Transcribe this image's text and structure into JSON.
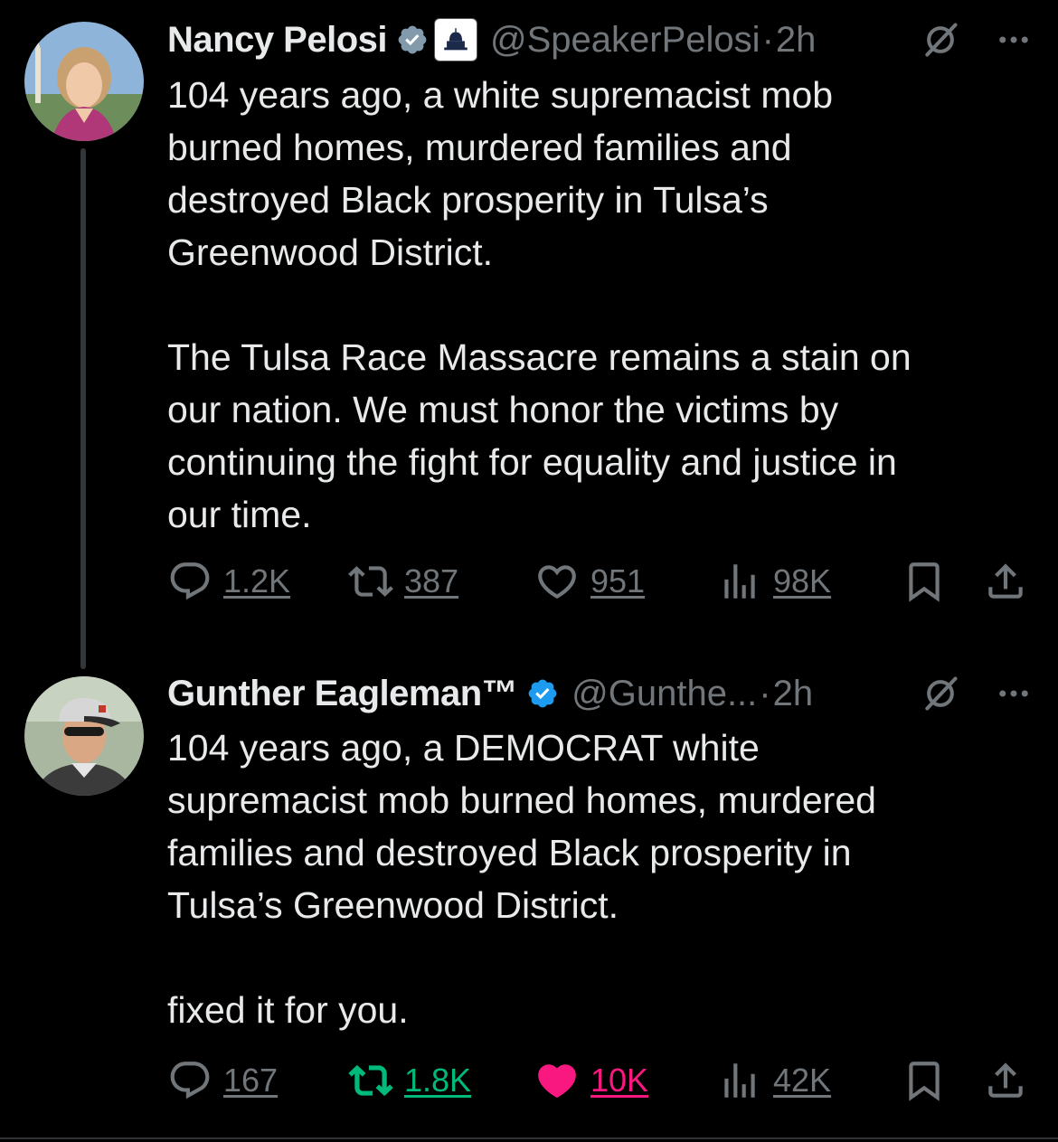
{
  "tweets": [
    {
      "name": "Nancy Pelosi",
      "handle": "@SpeakerPelosi",
      "separator": "·",
      "time": "2h",
      "text": "104 years ago, a white supremacist mob\nburned homes, murdered families and\ndestroyed Black prosperity in Tulsa’s\nGreenwood District.\n\nThe Tulsa Race Massacre remains a stain on\nour nation. We must honor the victims by\ncontinuing the fight for equality and justice in\nour time.",
      "verified_badge": "gray",
      "affiliation_icon": "capitol-dome-icon",
      "stats": {
        "replies": "1.2K",
        "reposts": "387",
        "likes": "951",
        "views": "98K"
      },
      "reposted": false,
      "liked": false
    },
    {
      "name": "Gunther Eagleman™",
      "handle": "@Gunthe...",
      "separator": "·",
      "time": "2h",
      "text": "104 years ago, a DEMOCRAT white\nsupremacist mob burned homes, murdered\nfamilies and destroyed Black prosperity in\nTulsa’s Greenwood District.\n\nfixed it for you.",
      "verified_badge": "blue",
      "stats": {
        "replies": "167",
        "reposts": "1.8K",
        "likes": "10K",
        "views": "42K"
      },
      "reposted": true,
      "liked": true
    }
  ],
  "colors": {
    "background": "#000000",
    "text": "#e7e9ea",
    "muted": "#71767b",
    "repost_active": "#00ba7c",
    "like_active": "#f91880",
    "verified_blue": "#1d9bf0",
    "verified_gray": "#829aab"
  }
}
